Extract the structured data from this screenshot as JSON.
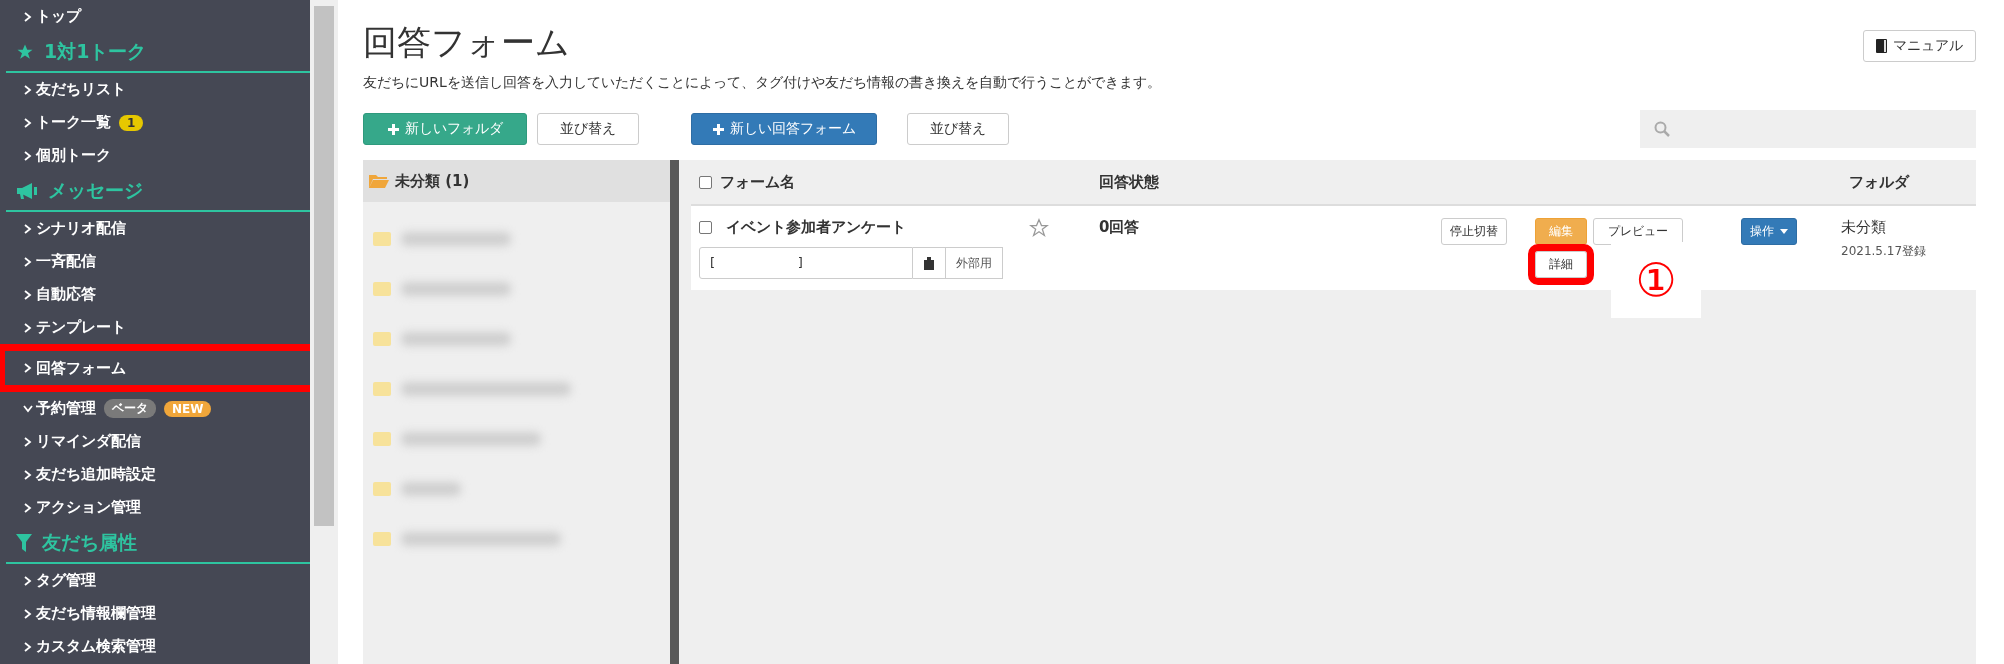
{
  "sidebar": {
    "items": [
      {
        "kind": "link",
        "label": "トップ",
        "expanded": false,
        "highlighted": false
      },
      {
        "kind": "header",
        "label": "1対1トーク"
      },
      {
        "kind": "link",
        "label": "友だちリスト",
        "expanded": false,
        "highlighted": false
      },
      {
        "kind": "link",
        "label": "トーク一覧",
        "expanded": false,
        "highlighted": false,
        "badges": [
          {
            "text": "1",
            "kind": "count"
          }
        ]
      },
      {
        "kind": "link",
        "label": "個別トーク",
        "expanded": false,
        "highlighted": false
      },
      {
        "kind": "header",
        "label": "メッセージ"
      },
      {
        "kind": "link",
        "label": "シナリオ配信",
        "expanded": false,
        "highlighted": false
      },
      {
        "kind": "link",
        "label": "一斉配信",
        "expanded": false,
        "highlighted": false
      },
      {
        "kind": "link",
        "label": "自動応答",
        "expanded": false,
        "highlighted": false
      },
      {
        "kind": "link",
        "label": "テンプレート",
        "expanded": false,
        "highlighted": false
      },
      {
        "kind": "link",
        "label": "回答フォーム",
        "expanded": false,
        "highlighted": true
      },
      {
        "kind": "link",
        "label": "予約管理",
        "expanded": true,
        "highlighted": false,
        "badges": [
          {
            "text": "ベータ",
            "kind": "beta"
          },
          {
            "text": "NEW",
            "kind": "new"
          }
        ]
      },
      {
        "kind": "link",
        "label": "リマインダ配信",
        "expanded": false,
        "highlighted": false
      },
      {
        "kind": "link",
        "label": "友だち追加時設定",
        "expanded": false,
        "highlighted": false
      },
      {
        "kind": "link",
        "label": "アクション管理",
        "expanded": false,
        "highlighted": false
      },
      {
        "kind": "header",
        "label": "友だち属性"
      },
      {
        "kind": "link",
        "label": "タグ管理",
        "expanded": false,
        "highlighted": false
      },
      {
        "kind": "link",
        "label": "友だち情報欄管理",
        "expanded": false,
        "highlighted": false
      },
      {
        "kind": "link",
        "label": "カスタム検索管理",
        "expanded": false,
        "highlighted": false
      }
    ]
  },
  "page": {
    "title": "回答フォーム",
    "description": "友だちにURLを送信し回答を入力していただくことによって、タグ付けや友だち情報の書き換えを自動で行うことができます。",
    "manual_button": "マニュアル"
  },
  "folder_toolbar": [
    {
      "label": "新しいフォルダ",
      "kind": "green"
    },
    {
      "label": "並び替え",
      "kind": "default"
    }
  ],
  "form_toolbar": [
    {
      "label": "新しい回答フォーム",
      "kind": "blue"
    },
    {
      "label": "並び替え",
      "kind": "default"
    }
  ],
  "folders": {
    "header": "未分類 (1)",
    "items": [
      {
        "kind": "redacted"
      },
      {
        "kind": "redacted"
      },
      {
        "kind": "redacted"
      },
      {
        "kind": "redacted"
      },
      {
        "kind": "redacted"
      },
      {
        "kind": "redacted"
      },
      {
        "kind": "redacted"
      }
    ]
  },
  "table": {
    "header_checked": false,
    "columns": [
      "フォーム名",
      "回答状態",
      "フォルダ"
    ],
    "rows": [
      {
        "checked": false,
        "name": "イベント参加者アンケート",
        "starred": false,
        "status": "0回答",
        "url": "[                    ]",
        "external_label": "外部用",
        "buttons": [
          {
            "label": "停止切替",
            "kind": "default",
            "highlighted": false
          },
          {
            "label": "編集",
            "kind": "warning",
            "highlighted": false
          },
          {
            "label": "プレビュー",
            "kind": "default",
            "highlighted": false
          },
          {
            "label": "詳細",
            "kind": "default",
            "highlighted": true
          }
        ],
        "menu_button": "操作",
        "folder": "未分類",
        "registered": "2021.5.17登録"
      }
    ]
  },
  "annotation": {
    "marker": "①"
  }
}
